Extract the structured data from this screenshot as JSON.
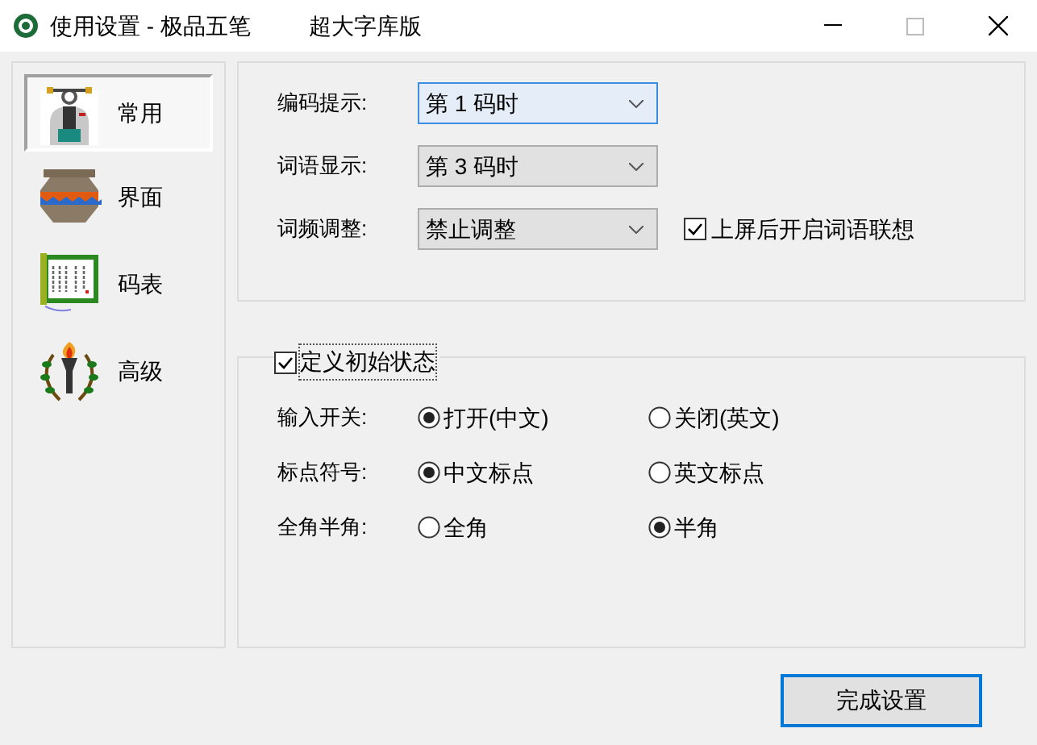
{
  "window": {
    "title": "使用设置 - 极品五笔",
    "title_suffix": "超大字库版"
  },
  "sidebar": {
    "items": [
      {
        "label": "常用",
        "selected": true
      },
      {
        "label": "界面",
        "selected": false
      },
      {
        "label": "码表",
        "selected": false
      },
      {
        "label": "高级",
        "selected": false
      }
    ]
  },
  "dropdowns": [
    {
      "label": "编码提示:",
      "value": "第 1 码时",
      "focused": true
    },
    {
      "label": "词语显示:",
      "value": "第 3 码时",
      "focused": false
    },
    {
      "label": "词频调整:",
      "value": "禁止调整",
      "focused": false
    }
  ],
  "association_checkbox": {
    "label": "上屏后开启词语联想",
    "checked": true
  },
  "initial_state": {
    "label": "定义初始状态",
    "checked": true,
    "rows": [
      {
        "label": "输入开关:",
        "options": [
          {
            "label": "打开(中文)",
            "selected": true
          },
          {
            "label": "关闭(英文)",
            "selected": false
          }
        ]
      },
      {
        "label": "标点符号:",
        "options": [
          {
            "label": "中文标点",
            "selected": true
          },
          {
            "label": "英文标点",
            "selected": false
          }
        ]
      },
      {
        "label": "全角半角:",
        "options": [
          {
            "label": "全角",
            "selected": false
          },
          {
            "label": "半角",
            "selected": true
          }
        ]
      }
    ]
  },
  "buttons": [
    "完成设置"
  ]
}
